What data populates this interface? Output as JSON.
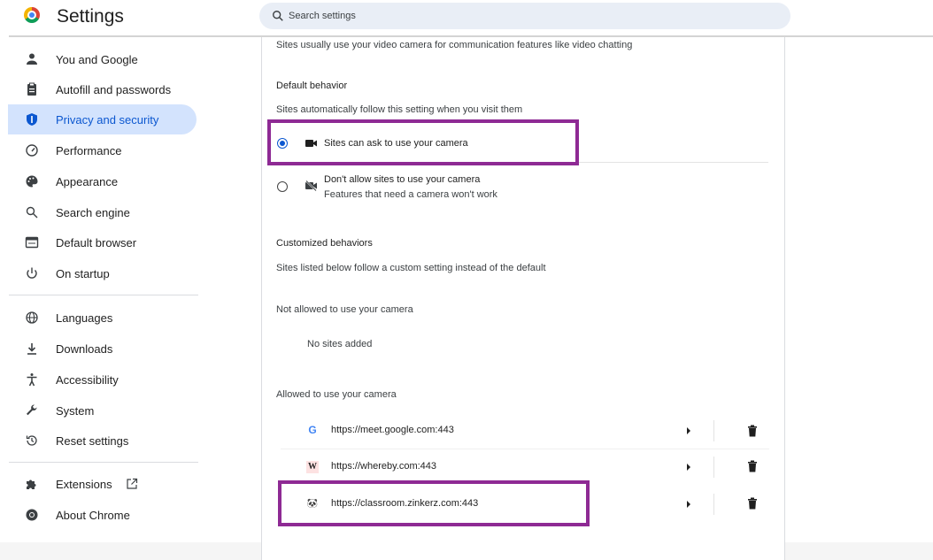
{
  "header": {
    "title": "Settings",
    "search_placeholder": "Search settings"
  },
  "sidebar": {
    "items": [
      {
        "label": "You and Google",
        "icon": "person-icon"
      },
      {
        "label": "Autofill and passwords",
        "icon": "clipboard-icon"
      },
      {
        "label": "Privacy and security",
        "icon": "shield-icon",
        "active": true
      },
      {
        "label": "Performance",
        "icon": "speedometer-icon"
      },
      {
        "label": "Appearance",
        "icon": "palette-icon"
      },
      {
        "label": "Search engine",
        "icon": "search-icon"
      },
      {
        "label": "Default browser",
        "icon": "browser-window-icon"
      },
      {
        "label": "On startup",
        "icon": "power-icon"
      },
      {
        "label": "Languages",
        "icon": "globe-icon"
      },
      {
        "label": "Downloads",
        "icon": "download-icon"
      },
      {
        "label": "Accessibility",
        "icon": "accessibility-icon"
      },
      {
        "label": "System",
        "icon": "wrench-icon"
      },
      {
        "label": "Reset settings",
        "icon": "reset-history-icon"
      },
      {
        "label": "Extensions",
        "icon": "puzzle-icon"
      },
      {
        "label": "About Chrome",
        "icon": "chrome-icon"
      }
    ]
  },
  "content": {
    "intro": "Sites usually use your video camera for communication features like video chatting",
    "default_behavior": {
      "heading": "Default behavior",
      "description": "Sites automatically follow this setting when you visit them",
      "options": [
        {
          "label": "Sites can ask to use your camera",
          "sublabel": "",
          "selected": true
        },
        {
          "label": "Don't allow sites to use your camera",
          "sublabel": "Features that need a camera won't work",
          "selected": false
        }
      ]
    },
    "customized": {
      "heading": "Customized behaviors",
      "description": "Sites listed below follow a custom setting instead of the default",
      "not_allowed_heading": "Not allowed to use your camera",
      "no_sites": "No sites added",
      "allowed_heading": "Allowed to use your camera",
      "allowed_sites": [
        {
          "url": "https://meet.google.com:443",
          "favicon": "G"
        },
        {
          "url": "https://whereby.com:443",
          "favicon": "W"
        },
        {
          "url": "https://classroom.zinkerz.com:443",
          "favicon": "🐼"
        }
      ]
    }
  },
  "colors": {
    "accent": "#0b57d0",
    "active_nav_bg": "#d3e3fd",
    "highlight_border": "#8e2a94"
  }
}
